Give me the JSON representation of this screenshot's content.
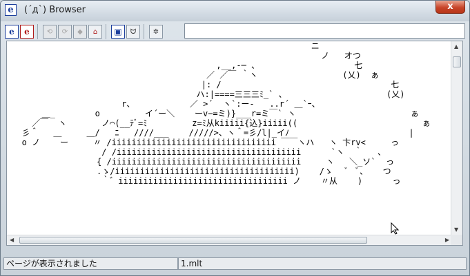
{
  "window": {
    "title": "(´д`) Browser",
    "app_icon_glyph": "e",
    "close_glyph": "x"
  },
  "toolbar": {
    "buttons": [
      {
        "name": "ie-home-button",
        "glyph": "e",
        "icon": "ie-blue-icon"
      },
      {
        "name": "ie-alt-button",
        "glyph": "e",
        "icon": "ie-red-icon"
      },
      {
        "name": "back-button",
        "glyph": "⟲",
        "icon": "back-cat-icon"
      },
      {
        "name": "forward-button",
        "glyph": "⟳",
        "icon": "forward-cat-icon"
      },
      {
        "name": "stop-button",
        "glyph": "◆",
        "icon": "stop-icon"
      },
      {
        "name": "home-button",
        "glyph": "⌂",
        "icon": "home-icon"
      },
      {
        "name": "window-button",
        "glyph": "▣",
        "icon": "window-icon"
      },
      {
        "name": "mona-button",
        "glyph": "ᗢ",
        "icon": "mona-face-icon"
      },
      {
        "name": "settings-button",
        "glyph": "✲",
        "icon": "gear-cat-icon"
      }
    ],
    "address_value": ""
  },
  "ascii_art": "                                                             ニ\n                                                               ノ   オつ\n                                          ,__,-─ 、                   七\n                                        ／ ／￣ ｀ヽ                 (乂)  ぁ\n                                       |: /                                  七\n                                      ハ:|====三三三ﾐ_` 、                    (乂)\n                       r、           ／ >´  ヽ`:ー-   ..r´ ＿`ｰ、\n       ＿_        o         イ´ー＼    ーv−=ミ)}___r=ミ￣` ヽ                       ぁ\n     ／￣  ヽ       ノ⌒(__ﾃﾞ=ﾐ         z=ﾐ从kiiiii{込}iiiii((                         ぁ\n   彡＾   ＿     ＿/   ﾆ   ////___    /////>、ヽ＾=彡/l|_イﾉ                        |\n   o ノ    ー     〃 /iiiiiiiiiiiiiiiiiiiiiiiiiiiiiiiii ￣￣ヽハ   ヽ 卞rv<     っ              |⌒し  ／\n                   / /iiiiiiiiiiiiiiiiiiiiiiiiiiiiiiiiiiiii      `ヽ  ｀   、                  ／\n                  { /iiiiiiiiiiiiiiiiiiiiiiiiiiiiiiiiiiiiii     ヽ   ＼_ソ`  っ                   ・\n                  .ゝ/iiiiiiiiiiiiiiiiiiiiiiiiiiiiiiiiiiii)    /ゝ   ﾞ  ﾞ、   つ\n                   ｀゛iiiiiiiiiiiiiiiiiiiiiiiiiiiiiiiiii ノ    〃从    )      っ",
  "status": {
    "message": "ページが表示されました",
    "file": "1.mlt"
  }
}
